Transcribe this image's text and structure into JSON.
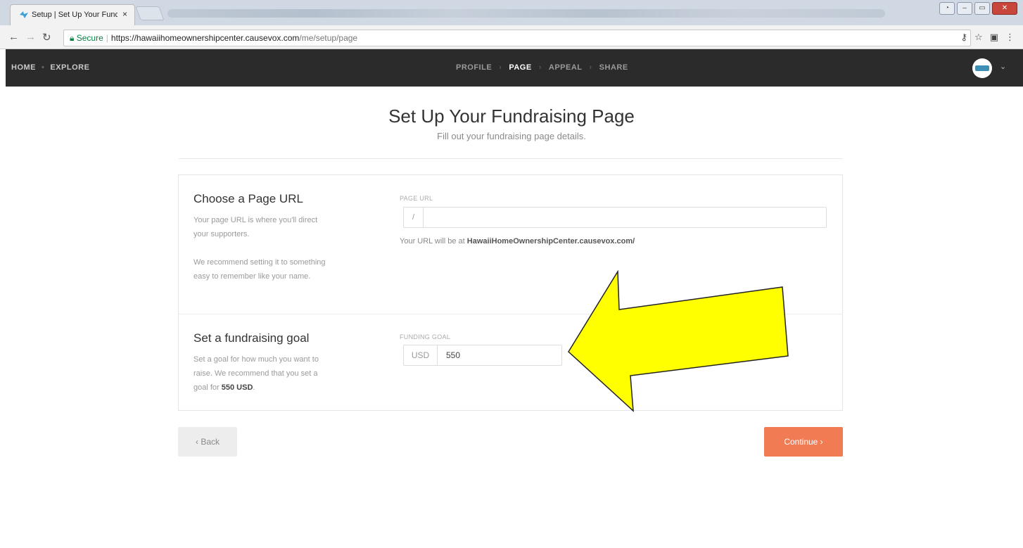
{
  "browser": {
    "tab_title": "Setup | Set Up Your Func",
    "tab_close": "×",
    "secure_label": "Secure",
    "url_host": "https://hawaiihomeownershipcenter.causevox.com",
    "url_path": "/me/setup/page"
  },
  "site_nav": {
    "home": "HOME",
    "explore": "EXPLORE"
  },
  "steps": {
    "profile": "PROFILE",
    "page": "PAGE",
    "appeal": "APPEAL",
    "share": "SHARE"
  },
  "page": {
    "heading": "Set Up Your Fundraising Page",
    "subheading": "Fill out your fundraising page details."
  },
  "url_section": {
    "title": "Choose a Page URL",
    "desc1": "Your page URL is where you'll direct your supporters.",
    "desc2": "We recommend setting it to something easy to remember like your name.",
    "field_label": "PAGE URL",
    "prefix": "/",
    "value": "",
    "hint_prefix": "Your URL will be at ",
    "hint_domain": "HawaiiHomeOwnershipCenter.causevox.com/"
  },
  "goal_section": {
    "title": "Set a fundraising goal",
    "desc_prefix": "Set a goal for how much you want to raise. We recommend that you set a goal for ",
    "desc_amount": "550 USD",
    "desc_suffix": ".",
    "field_label": "FUNDING GOAL",
    "currency": "USD",
    "value": "550"
  },
  "buttons": {
    "back": "‹ Back",
    "continue": "Continue ›"
  },
  "colors": {
    "header_bg": "#2b2b2b",
    "continue_bg": "#f17b53",
    "arrow_fill": "#ffff00"
  }
}
